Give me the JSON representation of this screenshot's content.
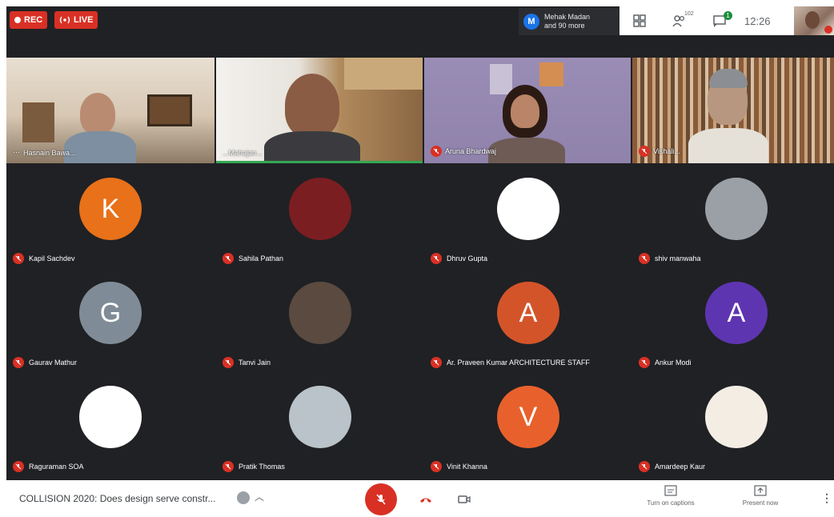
{
  "status": {
    "rec_label": "REC",
    "live_label": "LIVE"
  },
  "presenter": {
    "initial": "M",
    "line1": "Mehak Madan",
    "line2": "and 90 more"
  },
  "toolbar": {
    "participants_count": "102",
    "chat_badge": "1",
    "time": "12:26"
  },
  "video_tiles": [
    {
      "name": "Hasnain Bawa..."
    },
    {
      "name": "...Mahajan..."
    },
    {
      "name": "Aruna Bhardwaj"
    },
    {
      "name": "Vishali..."
    }
  ],
  "participants": [
    {
      "name": "Kapil Sachdev",
      "initial": "K",
      "color": "#e8711a"
    },
    {
      "name": "Sahila Pathan",
      "initial": "",
      "color": "#7a1e22"
    },
    {
      "name": "Dhruv Gupta",
      "initial": "",
      "color": "#ffffff"
    },
    {
      "name": "shiv manwaha",
      "initial": "",
      "color": "#9aa0a6"
    },
    {
      "name": "Gaurav Mathur",
      "initial": "G",
      "color": "#7f8c97"
    },
    {
      "name": "Tanvi Jain",
      "initial": "",
      "color": "#5a4a40"
    },
    {
      "name": "Ar. Praveen Kumar ARCHITECTURE STAFF",
      "initial": "A",
      "color": "#d4542a"
    },
    {
      "name": "Ankur Modi",
      "initial": "A",
      "color": "#5e35b1"
    },
    {
      "name": "Raguraman SOA",
      "initial": "",
      "color": "#ffffff"
    },
    {
      "name": "Pratik Thomas",
      "initial": "",
      "color": "#b9c3c9"
    },
    {
      "name": "Vinit Khanna",
      "initial": "V",
      "color": "#e8612c"
    },
    {
      "name": "Amardeep Kaur",
      "initial": "",
      "color": "#f3ede4"
    }
  ],
  "meeting": {
    "title": "COLLISION 2020: Does design serve constr..."
  },
  "actions": {
    "captions_label": "Turn on captions",
    "present_label": "Present now"
  }
}
